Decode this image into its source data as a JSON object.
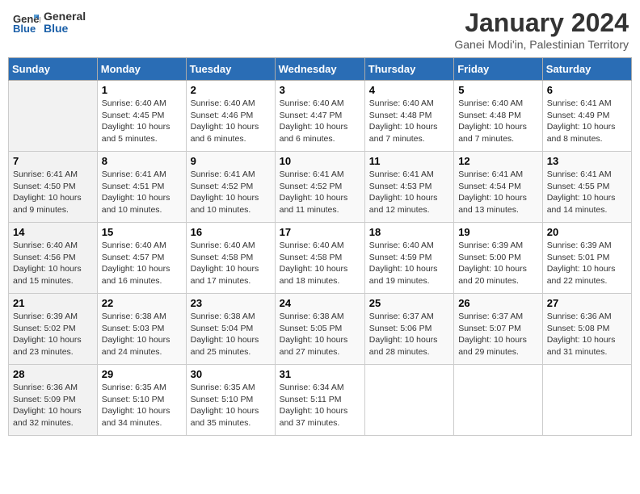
{
  "header": {
    "logo_line1": "General",
    "logo_line2": "Blue",
    "title": "January 2024",
    "subtitle": "Ganei Modi'in, Palestinian Territory"
  },
  "days_of_week": [
    "Sunday",
    "Monday",
    "Tuesday",
    "Wednesday",
    "Thursday",
    "Friday",
    "Saturday"
  ],
  "weeks": [
    [
      {
        "day": "",
        "sunrise": "",
        "sunset": "",
        "daylight": ""
      },
      {
        "day": "1",
        "sunrise": "Sunrise: 6:40 AM",
        "sunset": "Sunset: 4:45 PM",
        "daylight": "Daylight: 10 hours and 5 minutes."
      },
      {
        "day": "2",
        "sunrise": "Sunrise: 6:40 AM",
        "sunset": "Sunset: 4:46 PM",
        "daylight": "Daylight: 10 hours and 6 minutes."
      },
      {
        "day": "3",
        "sunrise": "Sunrise: 6:40 AM",
        "sunset": "Sunset: 4:47 PM",
        "daylight": "Daylight: 10 hours and 6 minutes."
      },
      {
        "day": "4",
        "sunrise": "Sunrise: 6:40 AM",
        "sunset": "Sunset: 4:48 PM",
        "daylight": "Daylight: 10 hours and 7 minutes."
      },
      {
        "day": "5",
        "sunrise": "Sunrise: 6:40 AM",
        "sunset": "Sunset: 4:48 PM",
        "daylight": "Daylight: 10 hours and 7 minutes."
      },
      {
        "day": "6",
        "sunrise": "Sunrise: 6:41 AM",
        "sunset": "Sunset: 4:49 PM",
        "daylight": "Daylight: 10 hours and 8 minutes."
      }
    ],
    [
      {
        "day": "7",
        "sunrise": "Sunrise: 6:41 AM",
        "sunset": "Sunset: 4:50 PM",
        "daylight": "Daylight: 10 hours and 9 minutes."
      },
      {
        "day": "8",
        "sunrise": "Sunrise: 6:41 AM",
        "sunset": "Sunset: 4:51 PM",
        "daylight": "Daylight: 10 hours and 10 minutes."
      },
      {
        "day": "9",
        "sunrise": "Sunrise: 6:41 AM",
        "sunset": "Sunset: 4:52 PM",
        "daylight": "Daylight: 10 hours and 10 minutes."
      },
      {
        "day": "10",
        "sunrise": "Sunrise: 6:41 AM",
        "sunset": "Sunset: 4:52 PM",
        "daylight": "Daylight: 10 hours and 11 minutes."
      },
      {
        "day": "11",
        "sunrise": "Sunrise: 6:41 AM",
        "sunset": "Sunset: 4:53 PM",
        "daylight": "Daylight: 10 hours and 12 minutes."
      },
      {
        "day": "12",
        "sunrise": "Sunrise: 6:41 AM",
        "sunset": "Sunset: 4:54 PM",
        "daylight": "Daylight: 10 hours and 13 minutes."
      },
      {
        "day": "13",
        "sunrise": "Sunrise: 6:41 AM",
        "sunset": "Sunset: 4:55 PM",
        "daylight": "Daylight: 10 hours and 14 minutes."
      }
    ],
    [
      {
        "day": "14",
        "sunrise": "Sunrise: 6:40 AM",
        "sunset": "Sunset: 4:56 PM",
        "daylight": "Daylight: 10 hours and 15 minutes."
      },
      {
        "day": "15",
        "sunrise": "Sunrise: 6:40 AM",
        "sunset": "Sunset: 4:57 PM",
        "daylight": "Daylight: 10 hours and 16 minutes."
      },
      {
        "day": "16",
        "sunrise": "Sunrise: 6:40 AM",
        "sunset": "Sunset: 4:58 PM",
        "daylight": "Daylight: 10 hours and 17 minutes."
      },
      {
        "day": "17",
        "sunrise": "Sunrise: 6:40 AM",
        "sunset": "Sunset: 4:58 PM",
        "daylight": "Daylight: 10 hours and 18 minutes."
      },
      {
        "day": "18",
        "sunrise": "Sunrise: 6:40 AM",
        "sunset": "Sunset: 4:59 PM",
        "daylight": "Daylight: 10 hours and 19 minutes."
      },
      {
        "day": "19",
        "sunrise": "Sunrise: 6:39 AM",
        "sunset": "Sunset: 5:00 PM",
        "daylight": "Daylight: 10 hours and 20 minutes."
      },
      {
        "day": "20",
        "sunrise": "Sunrise: 6:39 AM",
        "sunset": "Sunset: 5:01 PM",
        "daylight": "Daylight: 10 hours and 22 minutes."
      }
    ],
    [
      {
        "day": "21",
        "sunrise": "Sunrise: 6:39 AM",
        "sunset": "Sunset: 5:02 PM",
        "daylight": "Daylight: 10 hours and 23 minutes."
      },
      {
        "day": "22",
        "sunrise": "Sunrise: 6:38 AM",
        "sunset": "Sunset: 5:03 PM",
        "daylight": "Daylight: 10 hours and 24 minutes."
      },
      {
        "day": "23",
        "sunrise": "Sunrise: 6:38 AM",
        "sunset": "Sunset: 5:04 PM",
        "daylight": "Daylight: 10 hours and 25 minutes."
      },
      {
        "day": "24",
        "sunrise": "Sunrise: 6:38 AM",
        "sunset": "Sunset: 5:05 PM",
        "daylight": "Daylight: 10 hours and 27 minutes."
      },
      {
        "day": "25",
        "sunrise": "Sunrise: 6:37 AM",
        "sunset": "Sunset: 5:06 PM",
        "daylight": "Daylight: 10 hours and 28 minutes."
      },
      {
        "day": "26",
        "sunrise": "Sunrise: 6:37 AM",
        "sunset": "Sunset: 5:07 PM",
        "daylight": "Daylight: 10 hours and 29 minutes."
      },
      {
        "day": "27",
        "sunrise": "Sunrise: 6:36 AM",
        "sunset": "Sunset: 5:08 PM",
        "daylight": "Daylight: 10 hours and 31 minutes."
      }
    ],
    [
      {
        "day": "28",
        "sunrise": "Sunrise: 6:36 AM",
        "sunset": "Sunset: 5:09 PM",
        "daylight": "Daylight: 10 hours and 32 minutes."
      },
      {
        "day": "29",
        "sunrise": "Sunrise: 6:35 AM",
        "sunset": "Sunset: 5:10 PM",
        "daylight": "Daylight: 10 hours and 34 minutes."
      },
      {
        "day": "30",
        "sunrise": "Sunrise: 6:35 AM",
        "sunset": "Sunset: 5:10 PM",
        "daylight": "Daylight: 10 hours and 35 minutes."
      },
      {
        "day": "31",
        "sunrise": "Sunrise: 6:34 AM",
        "sunset": "Sunset: 5:11 PM",
        "daylight": "Daylight: 10 hours and 37 minutes."
      },
      {
        "day": "",
        "sunrise": "",
        "sunset": "",
        "daylight": ""
      },
      {
        "day": "",
        "sunrise": "",
        "sunset": "",
        "daylight": ""
      },
      {
        "day": "",
        "sunrise": "",
        "sunset": "",
        "daylight": ""
      }
    ]
  ]
}
